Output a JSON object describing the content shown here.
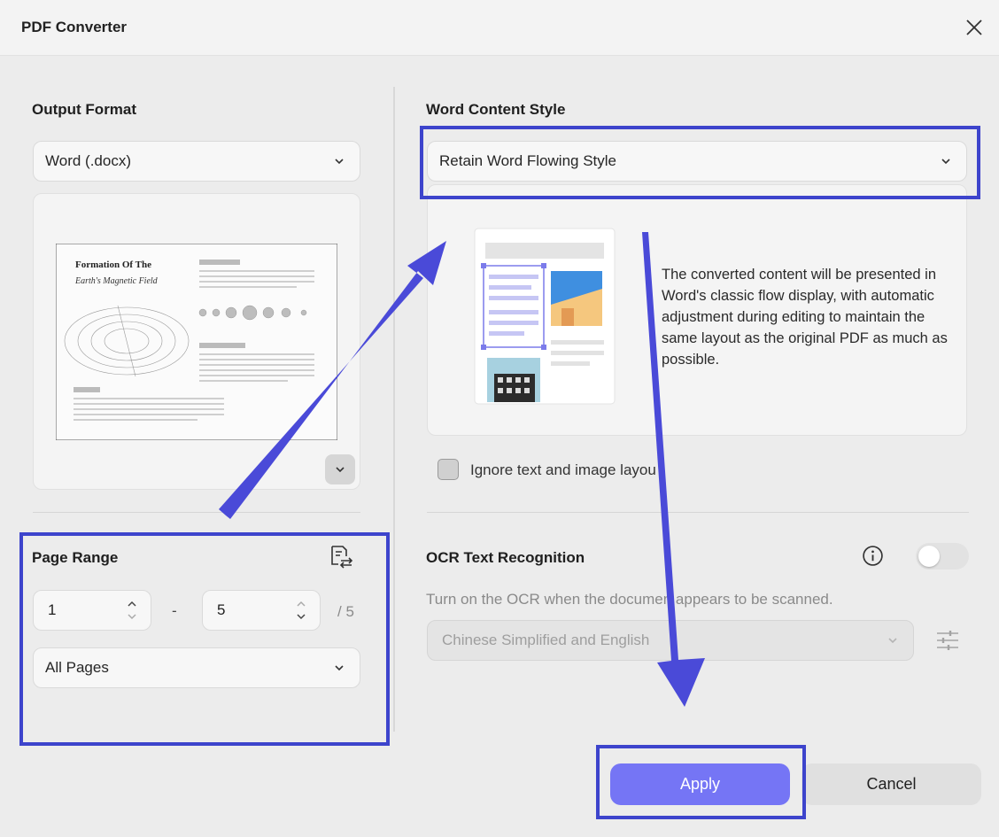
{
  "window": {
    "title": "PDF Converter"
  },
  "output_format": {
    "label": "Output Format",
    "selected": "Word (.docx)",
    "preview": {
      "doc_title_line1": "Formation Of The",
      "doc_title_line2": "Earth's Magnetic Field"
    }
  },
  "page_range": {
    "label": "Page Range",
    "from": "1",
    "separator": "-",
    "to": "5",
    "total": "/ 5",
    "selected": "All Pages"
  },
  "word_content_style": {
    "label": "Word Content Style",
    "selected": "Retain Word Flowing Style",
    "description": "The converted content will be presented in Word's classic flow display, with automatic adjustment during editing to maintain the same layout as the original PDF as much as possible.",
    "checkbox_label": "Ignore text and image layou",
    "checkbox_checked": false
  },
  "ocr": {
    "label": "OCR Text Recognition",
    "enabled": false,
    "hint": "Turn on the OCR when the documen appears to be scanned.",
    "language": "Chinese Simplified and English"
  },
  "buttons": {
    "apply": "Apply",
    "cancel": "Cancel"
  },
  "colors": {
    "accent": "#7575f5",
    "highlight": "#3d44cc"
  }
}
